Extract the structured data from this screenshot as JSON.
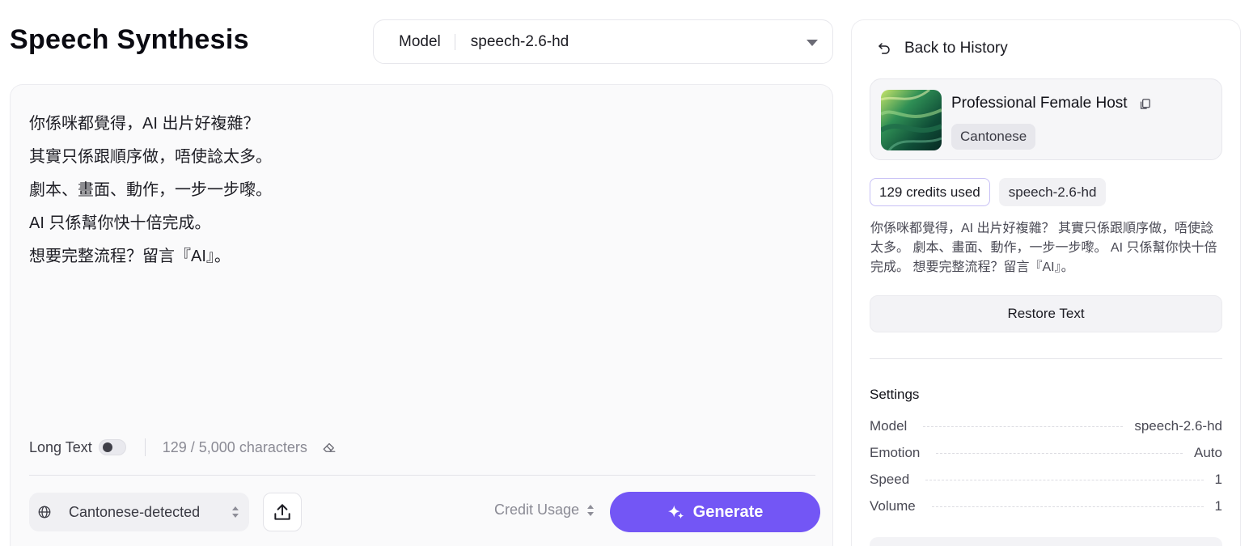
{
  "page": {
    "title": "Speech Synthesis"
  },
  "model_select": {
    "label": "Model",
    "value": "speech-2.6-hd"
  },
  "editor": {
    "lines": [
      "你係咪都覺得，AI 出片好複雜？",
      "其實只係跟順序做，唔使諗太多。",
      "劇本、畫面、動作，一步一步嚟。",
      "AI 只係幫你快十倍完成。",
      "想要完整流程？留言『AI』。"
    ],
    "long_text_label": "Long Text",
    "long_text_enabled": false,
    "char_count": "129 / 5,000 characters"
  },
  "footer": {
    "language_value": "Cantonese-detected",
    "credit_usage_label": "Credit Usage",
    "generate_label": "Generate"
  },
  "history_panel": {
    "back_label": "Back to History",
    "voice": {
      "name": "Professional Female Host",
      "language": "Cantonese"
    },
    "credits_tag": "129 credits used",
    "model_tag": "speech-2.6-hd",
    "preview_text": "你係咪都覺得，AI 出片好複雜？ 其實只係跟順序做，唔使諗太多。 劇本、畫面、動作，一步一步嚟。 AI 只係幫你快十倍完成。 想要完整流程？留言『AI』。",
    "restore_label": "Restore Text",
    "settings_title": "Settings",
    "settings": [
      {
        "label": "Model",
        "value": "speech-2.6-hd"
      },
      {
        "label": "Emotion",
        "value": "Auto"
      },
      {
        "label": "Speed",
        "value": "1"
      },
      {
        "label": "Volume",
        "value": "1"
      }
    ]
  },
  "colors": {
    "accent": "#7356f5",
    "credits_border": "#c7c0f5",
    "panel_bg": "#fafafb"
  },
  "icons": {
    "back": "undo-arrow-icon",
    "copy": "copy-icon",
    "eraser": "eraser-icon",
    "globe": "globe-icon",
    "upload": "upload-icon",
    "generate": "sparkle-icon",
    "model_caret": "caret-down-icon"
  }
}
